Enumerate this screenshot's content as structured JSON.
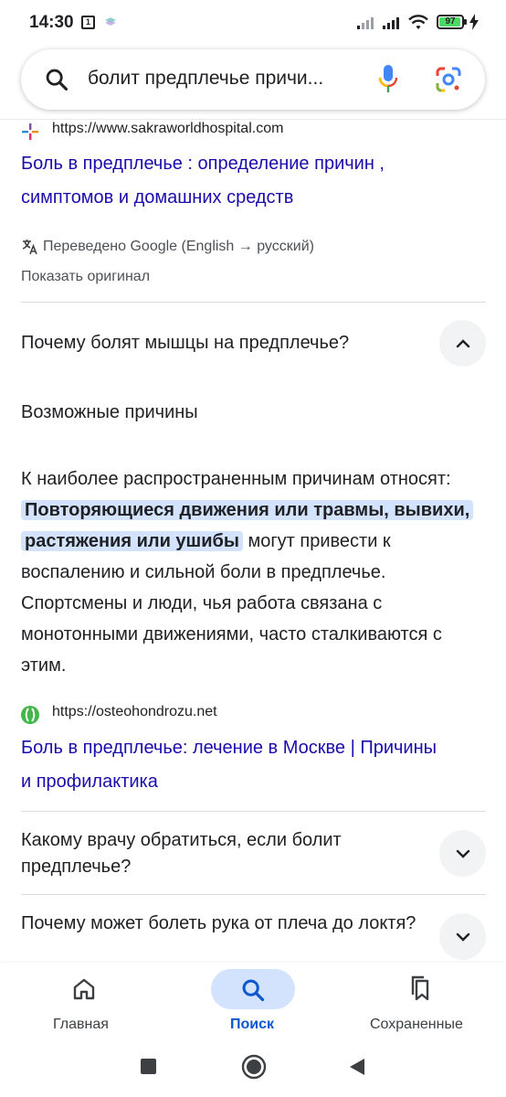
{
  "status_bar": {
    "time": "14:30",
    "sim_label": "1",
    "battery": "97"
  },
  "search": {
    "query": "болит предплечье причи..."
  },
  "result1": {
    "url": "https://www.sakraworldhospital.com",
    "title_line1": "Боль в предплечье : определение причин ,",
    "title_line2": "симптомов и домашних средств",
    "translated": "Переведено Google (English → русский)",
    "show_original": "Показать оригинал"
  },
  "faq": [
    {
      "question": "Почему болят мышцы на предплечье?",
      "expanded": true
    },
    {
      "question": "Какому врачу обратиться, если болит предплечье?",
      "expanded": false
    },
    {
      "question": "Почему может болеть рука от плеча до локтя?",
      "expanded": false
    }
  ],
  "answer": {
    "heading": "Возможные причины",
    "text_before": "К наиболее распространенным причинам относят: ",
    "highlight": "Повторяющиеся движения или травмы, вывихи, растяжения или ушибы",
    "text_after": " могут привести к воспалению и сильной боли в предплечье. Спортсмены и люди, чья работа связана с монотонными движениями, часто сталкиваются с этим."
  },
  "result2": {
    "url": "https://osteohondrozu.net",
    "title_line1": "Боль в предплечье: лечение в Москве | Причины",
    "title_line2": "и профилактика"
  },
  "bottom_nav": {
    "home": "Главная",
    "search": "Поиск",
    "saved": "Сохраненные"
  },
  "colors": {
    "link": "#1a0dab",
    "highlight": "#d3e3fd",
    "active_nav": "#0b57d0"
  }
}
